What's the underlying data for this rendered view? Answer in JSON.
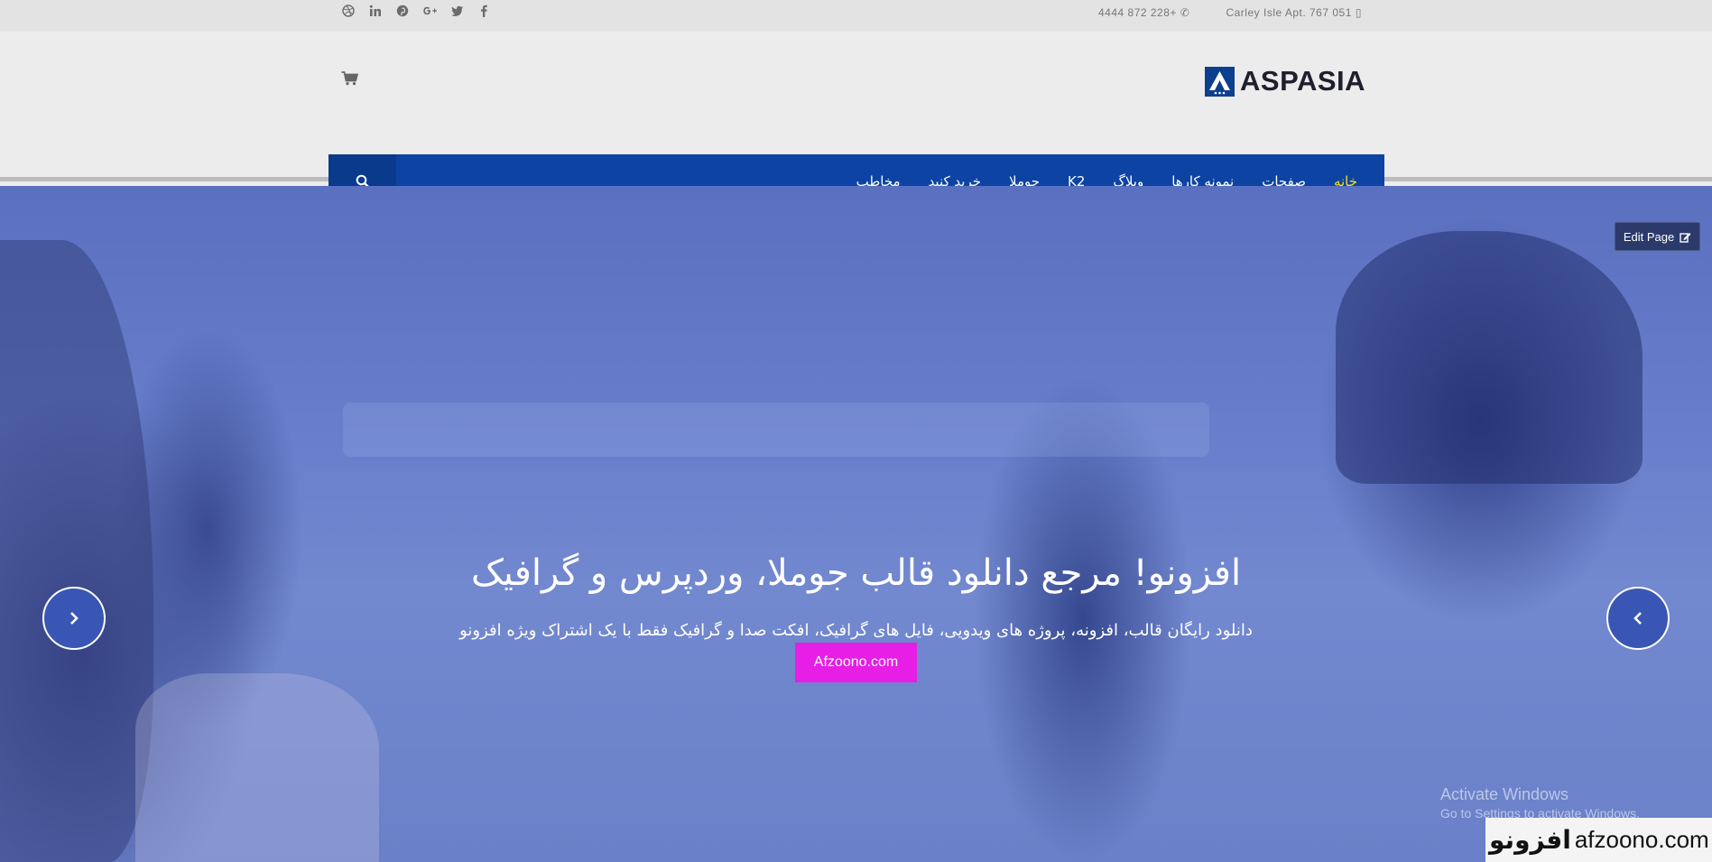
{
  "topbar": {
    "social_icons": [
      "dribbble-icon",
      "linkedin-icon",
      "pinterest-icon",
      "google-plus-icon",
      "twitter-icon",
      "facebook-icon"
    ],
    "phone": "4444 872 228+",
    "address": "Carley Isle Apt. 767 051"
  },
  "header": {
    "logo_text": "ASPASIA"
  },
  "nav": {
    "items": [
      {
        "label": "خانه",
        "active": true
      },
      {
        "label": "صفحات",
        "active": false
      },
      {
        "label": "نمونه کارها",
        "active": false
      },
      {
        "label": "وبلاگ",
        "active": false
      },
      {
        "label": "K2",
        "active": false
      },
      {
        "label": "جوملا",
        "active": false
      },
      {
        "label": "خرید کنید",
        "active": false
      },
      {
        "label": "مخاطب",
        "active": false
      }
    ]
  },
  "hero": {
    "title": "افزونو! مرجع دانلود قالب جوملا، وردپرس و گرافیک",
    "subtitle": "دانلود رایگان قالب، افزونه، پروژه های ویدویی، فایل های گرافیک، افکت صدا و گرافیک فقط با یک اشتراک ویژه افزونو",
    "button": "Afzoono.com"
  },
  "edit_page": "Edit Page",
  "os_notice": {
    "line1": "Activate Windows",
    "line2": "Go to Settings to activate Windows."
  },
  "watermark": {
    "fa": "افزونو",
    "en": "afzoono.com"
  },
  "colors": {
    "nav_bg": "#0d44a3",
    "nav_active": "#f6e11b",
    "hero_button": "#e61ee6",
    "logo_mark": "#0d3f8f"
  }
}
